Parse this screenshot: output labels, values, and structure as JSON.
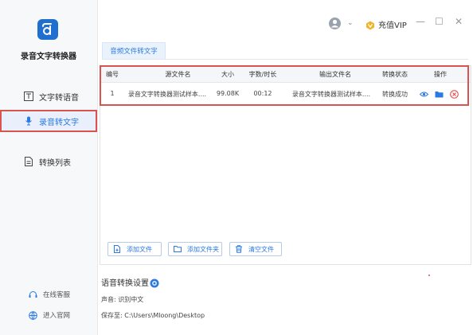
{
  "app": {
    "name": "录音文字转换器"
  },
  "sidebar": {
    "items": [
      {
        "label": "文字转语音",
        "icon": "text-box-icon"
      },
      {
        "label": "录音转文字",
        "icon": "microphone-icon"
      },
      {
        "label": "转换列表",
        "icon": "file-list-icon"
      }
    ],
    "footer": [
      {
        "label": "在线客服",
        "icon": "headset-icon"
      },
      {
        "label": "进入官网",
        "icon": "globe-icon"
      }
    ]
  },
  "topbar": {
    "vip_label": "充值VIP",
    "minimize": "—",
    "maximize": "☐",
    "close": "✕"
  },
  "tabs": [
    {
      "label": "音频文件转文字"
    }
  ],
  "table": {
    "headers": [
      "编号",
      "源文件名",
      "大小",
      "字数/时长",
      "输出文件名",
      "转换状态",
      "操作"
    ],
    "rows": [
      {
        "no": "1",
        "source": "录音文字转换器测试样本....",
        "size": "99.08K",
        "duration": "00:12",
        "output": "录音文字转换器测试样本....",
        "status": "成功"
      }
    ],
    "status_prefix": "转换"
  },
  "actions": {
    "add_file": "添加文件",
    "add_folder": "添加文件夹",
    "clear_files": "清空文件"
  },
  "settings": {
    "title": "语音转换设置",
    "voice_label": "声音:",
    "voice_value": "识别中文",
    "save_label": "保存至:",
    "save_path": "C:\\Users\\Mloong\\Desktop"
  },
  "colors": {
    "accent": "#2a7ae2",
    "highlight": "#d9534f",
    "logo": "#1f6fd1"
  }
}
